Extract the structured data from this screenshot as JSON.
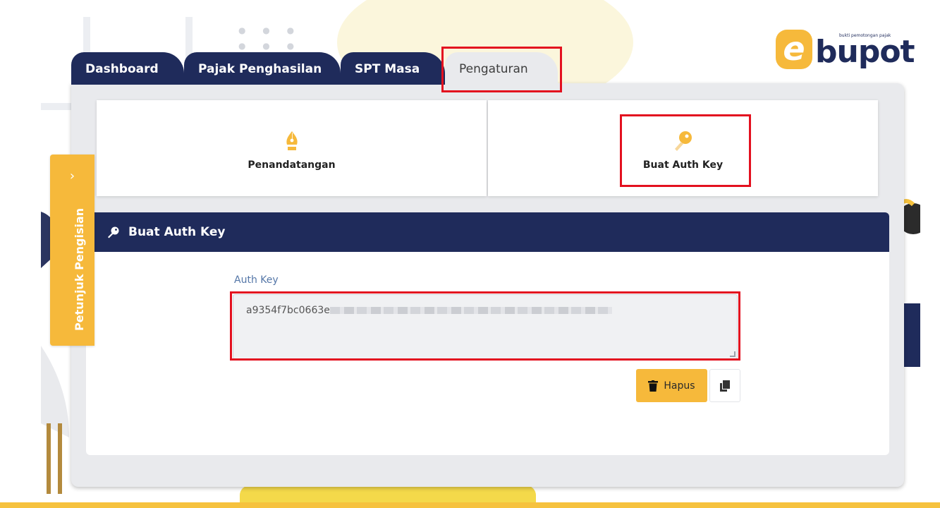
{
  "tabs": [
    {
      "label": "Dashboard",
      "active": false
    },
    {
      "label": "Pajak Penghasilan",
      "active": false
    },
    {
      "label": "SPT Masa",
      "active": false
    },
    {
      "label": "Pengaturan",
      "active": true
    }
  ],
  "logo": {
    "letter": "e",
    "name": "bupot",
    "tagline": "bukti pemotongan pajak"
  },
  "side_tab": {
    "label": "Petunjuk Pengisian",
    "chevron": "›"
  },
  "cards": [
    {
      "label": "Penandatangan",
      "icon": "pen-nib-icon"
    },
    {
      "label": "Buat Auth Key",
      "icon": "key-icon"
    }
  ],
  "form": {
    "header": "Buat Auth Key",
    "field_label": "Auth Key",
    "field_value_visible": "a9354f7bc0663e",
    "delete_label": "Hapus"
  },
  "colors": {
    "navy": "#1f2b5b",
    "yellow": "#f6b93b",
    "highlight": "#e3101f"
  }
}
